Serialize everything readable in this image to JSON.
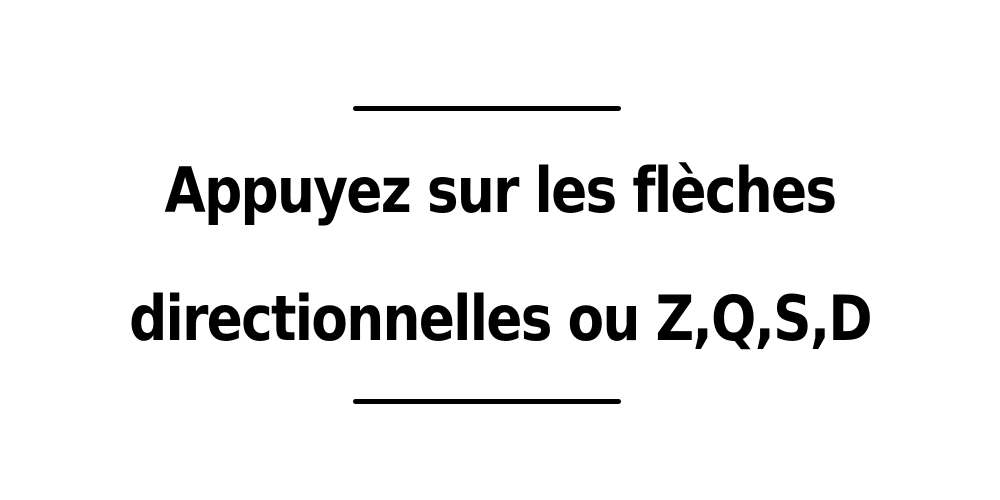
{
  "instruction": {
    "line1": "Appuyez sur les flèches",
    "line2": "directionnelles ou Z,Q,S,D"
  },
  "colors": {
    "background": "#ffffff",
    "text": "#000000",
    "divider": "#000000"
  }
}
